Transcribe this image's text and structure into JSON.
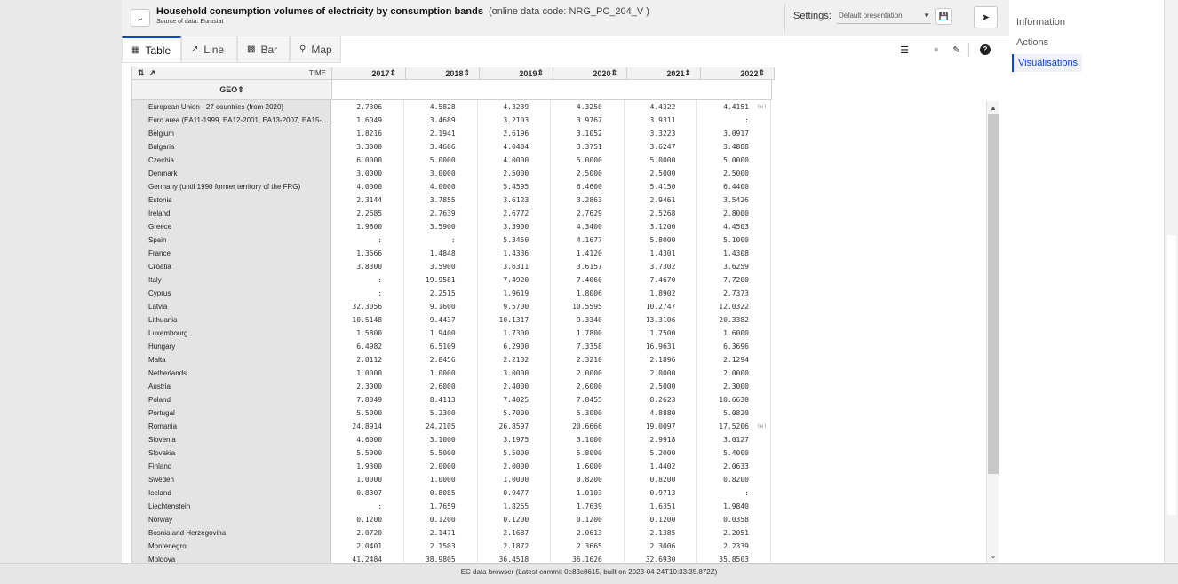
{
  "header": {
    "title": "Household consumption volumes of electricity by consumption bands",
    "code": "(online data code: NRG_PC_204_V )",
    "source": "Source of data: Eurostat",
    "settings_label": "Settings:",
    "settings_value": "Default presentation"
  },
  "tabs": [
    {
      "label": "Table",
      "icon": "table-icon"
    },
    {
      "label": "Line",
      "icon": "line-chart-icon"
    },
    {
      "label": "Bar",
      "icon": "bar-chart-icon"
    },
    {
      "label": "Map",
      "icon": "map-pin-icon"
    }
  ],
  "table": {
    "time_label": "TIME",
    "geo_label": "GEO",
    "years": [
      "2017",
      "2018",
      "2019",
      "2020",
      "2021",
      "2022"
    ],
    "rows": [
      {
        "geo": "European Union - 27 countries (from 2020)",
        "values": [
          "2.7306",
          "4.5828",
          "4.3239",
          "4.3250",
          "4.4322",
          "4.4151"
        ],
        "flags": [
          "",
          "",
          "",
          "",
          "",
          "(e)"
        ]
      },
      {
        "geo": "Euro area (EA11-1999, EA12-2001, EA13-2007, EA15-2...",
        "values": [
          "1.6049",
          "3.4689",
          "3.2103",
          "3.9767",
          "3.9311",
          ":"
        ],
        "flags": [
          "",
          "",
          "",
          "",
          "",
          ""
        ]
      },
      {
        "geo": "Belgium",
        "values": [
          "1.8216",
          "2.1941",
          "2.6196",
          "3.1052",
          "3.3223",
          "3.0917"
        ],
        "flags": [
          "",
          "",
          "",
          "",
          "",
          ""
        ]
      },
      {
        "geo": "Bulgaria",
        "values": [
          "3.3000",
          "3.4606",
          "4.0404",
          "3.3751",
          "3.6247",
          "3.4888"
        ],
        "flags": [
          "",
          "",
          "",
          "",
          "",
          ""
        ]
      },
      {
        "geo": "Czechia",
        "values": [
          "6.0000",
          "5.0000",
          "4.0000",
          "5.0000",
          "5.0000",
          "5.0000"
        ],
        "flags": [
          "",
          "",
          "",
          "",
          "",
          ""
        ]
      },
      {
        "geo": "Denmark",
        "values": [
          "3.0000",
          "3.0000",
          "2.5000",
          "2.5000",
          "2.5000",
          "2.5000"
        ],
        "flags": [
          "",
          "",
          "",
          "",
          "",
          ""
        ]
      },
      {
        "geo": "Germany (until 1990 former territory of the FRG)",
        "values": [
          "4.0000",
          "4.0000",
          "5.4595",
          "6.4600",
          "5.4150",
          "6.4400"
        ],
        "flags": [
          "",
          "",
          "",
          "",
          "",
          ""
        ]
      },
      {
        "geo": "Estonia",
        "values": [
          "2.3144",
          "3.7855",
          "3.6123",
          "3.2863",
          "2.9461",
          "3.5426"
        ],
        "flags": [
          "",
          "",
          "",
          "",
          "",
          ""
        ]
      },
      {
        "geo": "Ireland",
        "values": [
          "2.2685",
          "2.7639",
          "2.6772",
          "2.7629",
          "2.5268",
          "2.8000"
        ],
        "flags": [
          "",
          "",
          "",
          "",
          "",
          ""
        ]
      },
      {
        "geo": "Greece",
        "values": [
          "1.9800",
          "3.5900",
          "3.3900",
          "4.3400",
          "3.1200",
          "4.4503"
        ],
        "flags": [
          "",
          "",
          "",
          "",
          "",
          ""
        ]
      },
      {
        "geo": "Spain",
        "values": [
          ":",
          ":",
          "5.3450",
          "4.1677",
          "5.8000",
          "5.1000"
        ],
        "flags": [
          "",
          "",
          "",
          "",
          "",
          ""
        ]
      },
      {
        "geo": "France",
        "values": [
          "1.3666",
          "1.4848",
          "1.4336",
          "1.4120",
          "1.4301",
          "1.4308"
        ],
        "flags": [
          "",
          "",
          "",
          "",
          "",
          ""
        ]
      },
      {
        "geo": "Croatia",
        "values": [
          "3.8300",
          "3.5900",
          "3.6311",
          "3.6157",
          "3.7302",
          "3.6259"
        ],
        "flags": [
          "",
          "",
          "",
          "",
          "",
          ""
        ]
      },
      {
        "geo": "Italy",
        "values": [
          ":",
          "19.9581",
          "7.4920",
          "7.4060",
          "7.4670",
          "7.7200"
        ],
        "flags": [
          "",
          "",
          "",
          "",
          "",
          ""
        ]
      },
      {
        "geo": "Cyprus",
        "values": [
          ":",
          "2.2515",
          "1.9619",
          "1.8006",
          "1.8902",
          "2.7373"
        ],
        "flags": [
          "",
          "",
          "",
          "",
          "",
          ""
        ]
      },
      {
        "geo": "Latvia",
        "values": [
          "32.3056",
          "9.1600",
          "9.5700",
          "10.5595",
          "10.2747",
          "12.0322"
        ],
        "flags": [
          "",
          "",
          "",
          "",
          "",
          ""
        ]
      },
      {
        "geo": "Lithuania",
        "values": [
          "10.5148",
          "9.4437",
          "10.1317",
          "9.3340",
          "13.3106",
          "20.3382"
        ],
        "flags": [
          "",
          "",
          "",
          "",
          "",
          ""
        ]
      },
      {
        "geo": "Luxembourg",
        "values": [
          "1.5800",
          "1.9400",
          "1.7300",
          "1.7800",
          "1.7500",
          "1.6000"
        ],
        "flags": [
          "",
          "",
          "",
          "",
          "",
          ""
        ]
      },
      {
        "geo": "Hungary",
        "values": [
          "6.4982",
          "6.5109",
          "6.2900",
          "7.3358",
          "16.9631",
          "6.3696"
        ],
        "flags": [
          "",
          "",
          "",
          "",
          "",
          ""
        ]
      },
      {
        "geo": "Malta",
        "values": [
          "2.8112",
          "2.8456",
          "2.2132",
          "2.3210",
          "2.1896",
          "2.1294"
        ],
        "flags": [
          "",
          "",
          "",
          "",
          "",
          ""
        ]
      },
      {
        "geo": "Netherlands",
        "values": [
          "1.0000",
          "1.0000",
          "3.0000",
          "2.0000",
          "2.0000",
          "2.0000"
        ],
        "flags": [
          "",
          "",
          "",
          "",
          "",
          ""
        ]
      },
      {
        "geo": "Austria",
        "values": [
          "2.3000",
          "2.6000",
          "2.4000",
          "2.6000",
          "2.5000",
          "2.3000"
        ],
        "flags": [
          "",
          "",
          "",
          "",
          "",
          ""
        ]
      },
      {
        "geo": "Poland",
        "values": [
          "7.8049",
          "8.4113",
          "7.4025",
          "7.8455",
          "8.2623",
          "10.6630"
        ],
        "flags": [
          "",
          "",
          "",
          "",
          "",
          ""
        ]
      },
      {
        "geo": "Portugal",
        "values": [
          "5.5000",
          "5.2300",
          "5.7000",
          "5.3000",
          "4.8880",
          "5.0820"
        ],
        "flags": [
          "",
          "",
          "",
          "",
          "",
          ""
        ]
      },
      {
        "geo": "Romania",
        "values": [
          "24.8914",
          "24.2105",
          "26.8597",
          "20.6666",
          "19.0097",
          "17.5206"
        ],
        "flags": [
          "",
          "",
          "",
          "",
          "",
          "(e)"
        ]
      },
      {
        "geo": "Slovenia",
        "values": [
          "4.6000",
          "3.1000",
          "3.1975",
          "3.1000",
          "2.9918",
          "3.0127"
        ],
        "flags": [
          "",
          "",
          "",
          "",
          "",
          ""
        ]
      },
      {
        "geo": "Slovakia",
        "values": [
          "5.5000",
          "5.5000",
          "5.5000",
          "5.8000",
          "5.2000",
          "5.4000"
        ],
        "flags": [
          "",
          "",
          "",
          "",
          "",
          ""
        ]
      },
      {
        "geo": "Finland",
        "values": [
          "1.9300",
          "2.0000",
          "2.0000",
          "1.6000",
          "1.4402",
          "2.0633"
        ],
        "flags": [
          "",
          "",
          "",
          "",
          "",
          ""
        ]
      },
      {
        "geo": "Sweden",
        "values": [
          "1.0000",
          "1.0000",
          "1.0000",
          "0.8200",
          "0.8200",
          "0.8200"
        ],
        "flags": [
          "",
          "",
          "",
          "",
          "",
          ""
        ]
      },
      {
        "geo": "Iceland",
        "values": [
          "0.8307",
          "0.8085",
          "0.9477",
          "1.0103",
          "0.9713",
          ":"
        ],
        "flags": [
          "",
          "",
          "",
          "",
          "",
          ""
        ]
      },
      {
        "geo": "Liechtenstein",
        "values": [
          ":",
          "1.7659",
          "1.8255",
          "1.7639",
          "1.6351",
          "1.9840"
        ],
        "flags": [
          "",
          "",
          "",
          "",
          "",
          ""
        ]
      },
      {
        "geo": "Norway",
        "values": [
          "0.1200",
          "0.1200",
          "0.1200",
          "0.1200",
          "0.1200",
          "0.0358"
        ],
        "flags": [
          "",
          "",
          "",
          "",
          "",
          ""
        ]
      },
      {
        "geo": "Bosnia and Herzegovina",
        "values": [
          "2.0720",
          "2.1471",
          "2.1687",
          "2.0613",
          "2.1385",
          "2.2051"
        ],
        "flags": [
          "",
          "",
          "",
          "",
          "",
          ""
        ]
      },
      {
        "geo": "Montenegro",
        "values": [
          "2.0401",
          "2.1503",
          "2.1872",
          "2.3665",
          "2.3006",
          "2.2339"
        ],
        "flags": [
          "",
          "",
          "",
          "",
          "",
          ""
        ]
      },
      {
        "geo": "Moldova",
        "values": [
          "41.2484",
          "38.9805",
          "36.4518",
          "36.1626",
          "32.6930",
          "35.8503"
        ],
        "flags": [
          "",
          "",
          "",
          "",
          "",
          ""
        ]
      }
    ]
  },
  "side_panel": {
    "items": [
      "Information",
      "Actions",
      "Visualisations"
    ],
    "active": "Visualisations"
  },
  "footer": {
    "text": "EC data browser (Latest commit 0e83c8615, built on 2023-04-24T10:33:35.872Z)"
  },
  "colors": {
    "accent": "#0e47cb",
    "row_label_bg": "#e4e4e4",
    "header_bg": "#f0f0f0"
  }
}
